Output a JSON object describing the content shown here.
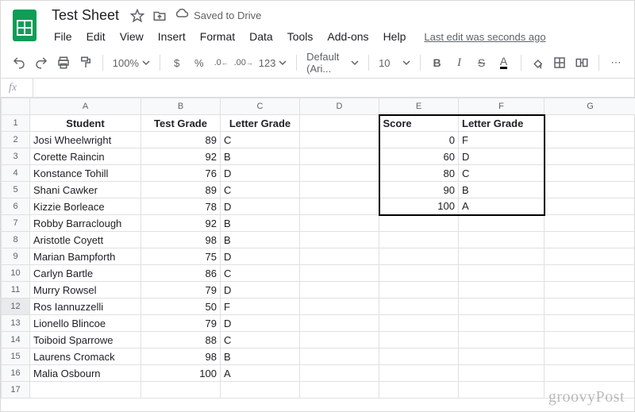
{
  "doc": {
    "title": "Test Sheet",
    "saved_text": "Saved to Drive",
    "last_edit": "Last edit was seconds ago"
  },
  "menus": [
    "File",
    "Edit",
    "View",
    "Insert",
    "Format",
    "Data",
    "Tools",
    "Add-ons",
    "Help"
  ],
  "toolbar": {
    "zoom": "100%",
    "more_formats": "123",
    "font": "Default (Ari...",
    "font_size": "10",
    "currency": "$",
    "percent": "%",
    "dec_dec": ".0",
    "inc_dec": ".00",
    "bold": "B",
    "italic": "I",
    "strike": "S",
    "textcolor": "A"
  },
  "fx_label": "fx",
  "columns": [
    "A",
    "B",
    "C",
    "D",
    "E",
    "F",
    "G"
  ],
  "headers": {
    "a": "Student",
    "b": "Test Grade",
    "c": "Letter Grade"
  },
  "students": [
    {
      "name": "Josi Wheelwright",
      "grade": 89,
      "letter": "C"
    },
    {
      "name": "Corette Raincin",
      "grade": 92,
      "letter": "B"
    },
    {
      "name": "Konstance Tohill",
      "grade": 76,
      "letter": "D"
    },
    {
      "name": "Shani Cawker",
      "grade": 89,
      "letter": "C"
    },
    {
      "name": "Kizzie Borleace",
      "grade": 78,
      "letter": "D"
    },
    {
      "name": "Robby Barraclough",
      "grade": 92,
      "letter": "B"
    },
    {
      "name": "Aristotle Coyett",
      "grade": 98,
      "letter": "B"
    },
    {
      "name": "Marian Bampforth",
      "grade": 75,
      "letter": "D"
    },
    {
      "name": "Carlyn Bartle",
      "grade": 86,
      "letter": "C"
    },
    {
      "name": "Murry Rowsel",
      "grade": 79,
      "letter": "D"
    },
    {
      "name": "Ros Iannuzzelli",
      "grade": 50,
      "letter": "F"
    },
    {
      "name": "Lionello Blincoe",
      "grade": 79,
      "letter": "D"
    },
    {
      "name": "Toiboid Sparrowe",
      "grade": 88,
      "letter": "C"
    },
    {
      "name": "Laurens Cromack",
      "grade": 98,
      "letter": "B"
    },
    {
      "name": "Malia Osbourn",
      "grade": 100,
      "letter": "A"
    }
  ],
  "lookup": {
    "hdr_score": "Score",
    "hdr_letter": "Letter Grade",
    "rows": [
      {
        "score": 0,
        "letter": "F"
      },
      {
        "score": 60,
        "letter": "D"
      },
      {
        "score": 80,
        "letter": "C"
      },
      {
        "score": 90,
        "letter": "B"
      },
      {
        "score": 100,
        "letter": "A"
      }
    ]
  },
  "selected_row": 12,
  "watermark": "groovyPost"
}
